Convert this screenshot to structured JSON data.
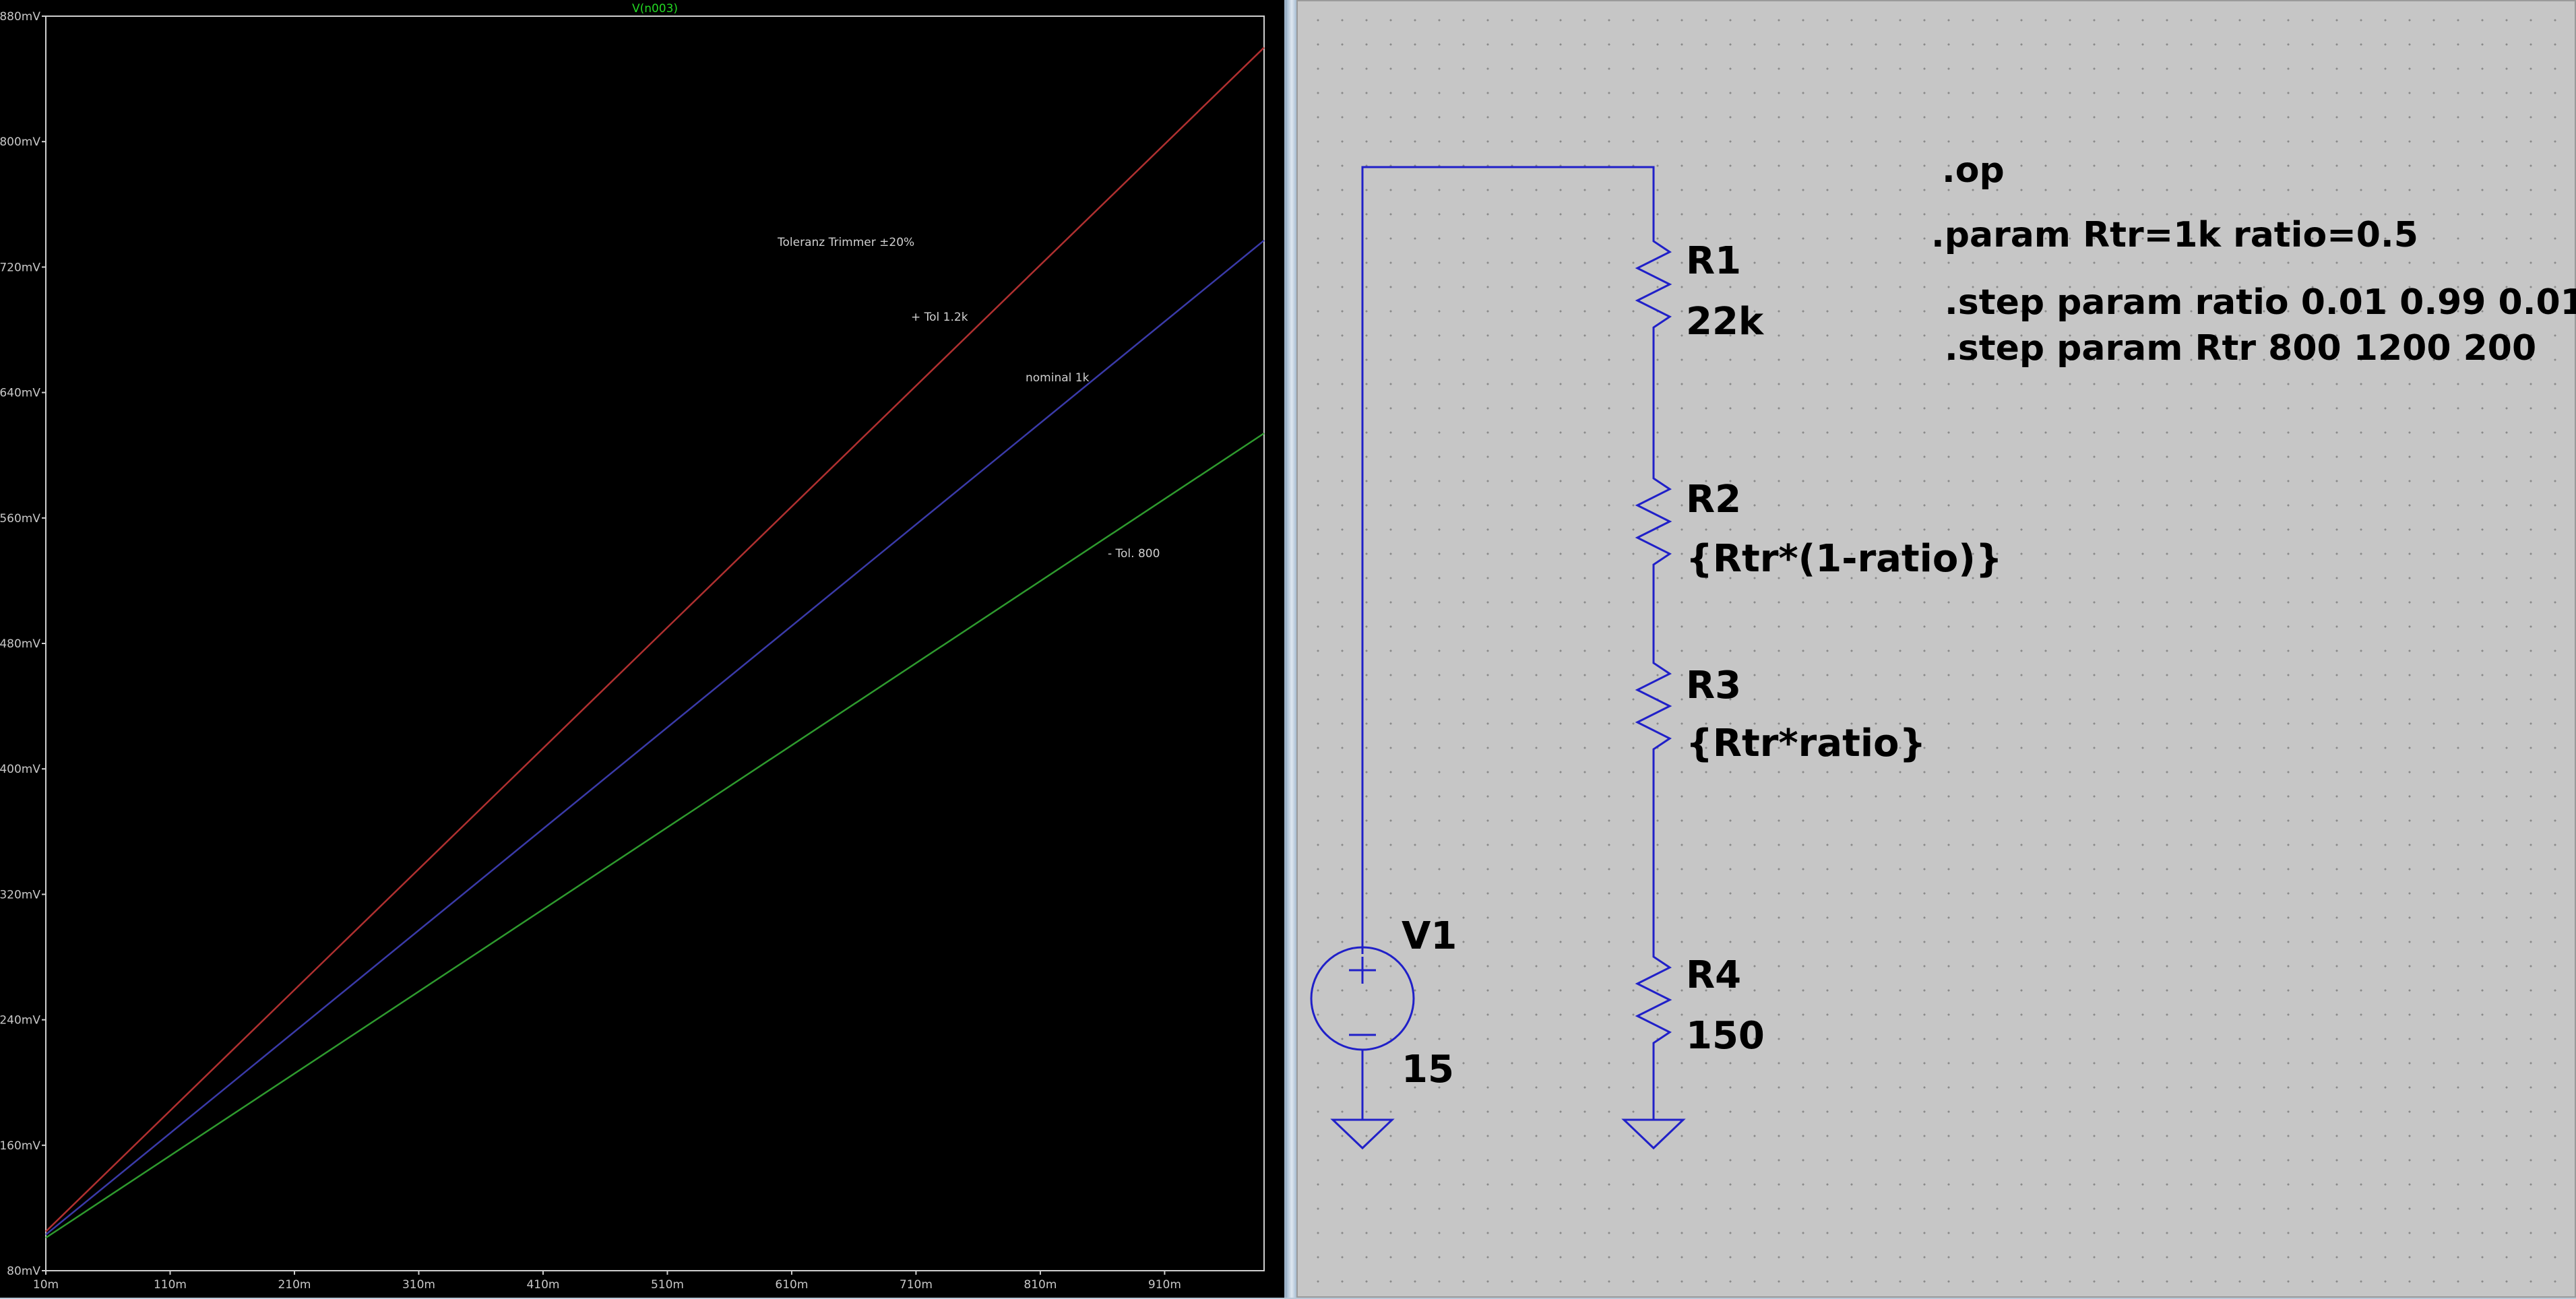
{
  "plot": {
    "trace_title": "V(n003)",
    "annotations": {
      "tolerance": "Toleranz Trimmer ±20%",
      "plus_tol": "+ Tol 1.2k",
      "nominal": "nominal 1k",
      "minus_tol": "- Tol. 800"
    },
    "colors": {
      "background": "#000000",
      "frame": "#cfcfcf",
      "title": "#22d822",
      "trace_plus": "#b03030",
      "trace_nominal": "#3a3aa8",
      "trace_minus": "#2e9a2e"
    }
  },
  "chart_data": {
    "type": "line",
    "title": "V(n003)",
    "xlabel": "",
    "ylabel": "",
    "xlim": [
      0.01,
      0.99
    ],
    "ylim": [
      0.08,
      0.88
    ],
    "x_ticks": [
      "10m",
      "110m",
      "210m",
      "310m",
      "410m",
      "510m",
      "610m",
      "710m",
      "810m",
      "910m"
    ],
    "y_ticks": [
      "80mV",
      "160mV",
      "240mV",
      "320mV",
      "400mV",
      "480mV",
      "560mV",
      "640mV",
      "720mV",
      "800mV",
      "880mV"
    ],
    "x": [
      0.01,
      0.99
    ],
    "series": [
      {
        "name": "+ Tol 1.2k",
        "color": "#b03030",
        "values": [
          0.105,
          0.86
        ]
      },
      {
        "name": "nominal 1k",
        "color": "#3a3aa8",
        "values": [
          0.103,
          0.737
        ]
      },
      {
        "name": "- Tol. 800",
        "color": "#2e9a2e",
        "values": [
          0.101,
          0.614
        ]
      }
    ],
    "grid": false,
    "legend": "none"
  },
  "schematic": {
    "directives": {
      "op": ".op",
      "param": ".param Rtr=1k ratio=0.5",
      "step_ratio": ".step param ratio 0.01 0.99 0.01",
      "step_rtr": ".step param Rtr 800 1200 200"
    },
    "components": {
      "r1": {
        "name": "R1",
        "value": "22k"
      },
      "r2": {
        "name": "R2",
        "value": "{Rtr*(1-ratio)}"
      },
      "r3": {
        "name": "R3",
        "value": "{Rtr*ratio}"
      },
      "r4": {
        "name": "R4",
        "value": "150"
      },
      "v1": {
        "name": "V1",
        "value": "15"
      }
    },
    "colors": {
      "wire": "#2020c8",
      "background": "#c6c6c6",
      "text": "#000000"
    }
  }
}
